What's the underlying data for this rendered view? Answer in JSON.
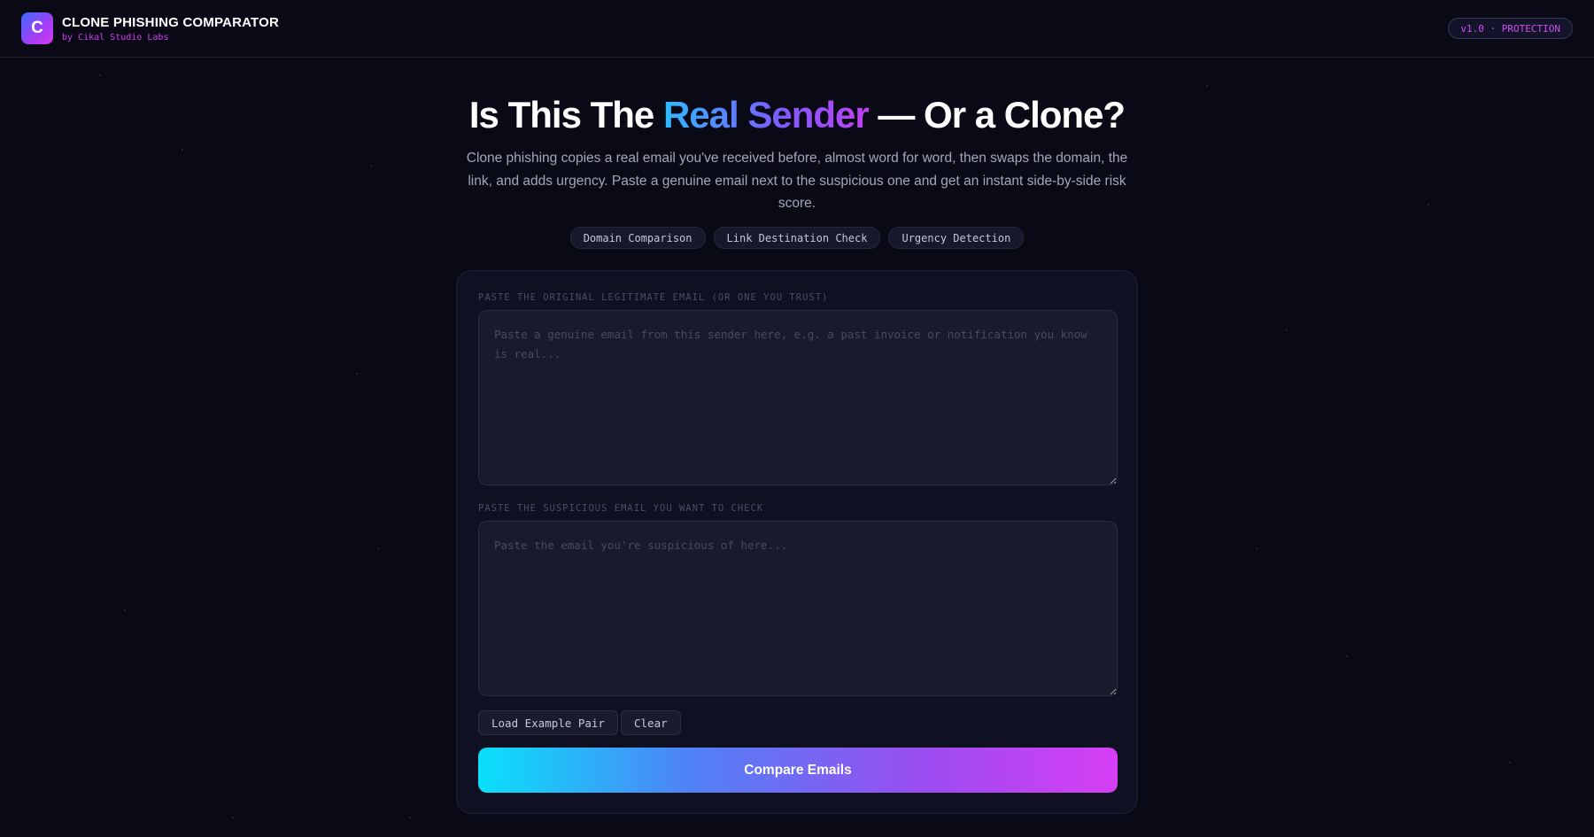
{
  "header": {
    "logo_letter": "C",
    "title": "CLONE PHISHING COMPARATOR",
    "subtitle": "by Cikal Studio Labs",
    "version_badge": "v1.0 · PROTECTION"
  },
  "hero": {
    "title_start": "Is This The ",
    "title_highlight": "Real Sender",
    "title_end": " — Or a Clone?",
    "description": "Clone phishing copies a real email you've received before, almost word for word, then swaps the domain, the link, and adds urgency. Paste a genuine email next to the suspicious one and get an instant side-by-side risk score.",
    "chips": [
      "Domain Comparison",
      "Link Destination Check",
      "Urgency Detection"
    ]
  },
  "form": {
    "original_label": "PASTE THE ORIGINAL LEGITIMATE EMAIL (OR ONE YOU TRUST)",
    "original_value": "",
    "original_placeholder": "Paste a genuine email from this sender here, e.g. a past invoice or notification you know is real...",
    "suspicious_label": "PASTE THE SUSPICIOUS EMAIL YOU WANT TO CHECK",
    "suspicious_value": "",
    "suspicious_placeholder": "Paste the email you're suspicious of here...",
    "load_example_label": "Load Example Pair",
    "clear_label": "Clear",
    "compare_label": "Compare Emails"
  },
  "colors": {
    "background": "#090a16",
    "card": "#0f1022",
    "accent_magenta": "#d33cf2",
    "accent_cyan": "#0ae0fb",
    "accent_violet": "#9b4cf0"
  }
}
